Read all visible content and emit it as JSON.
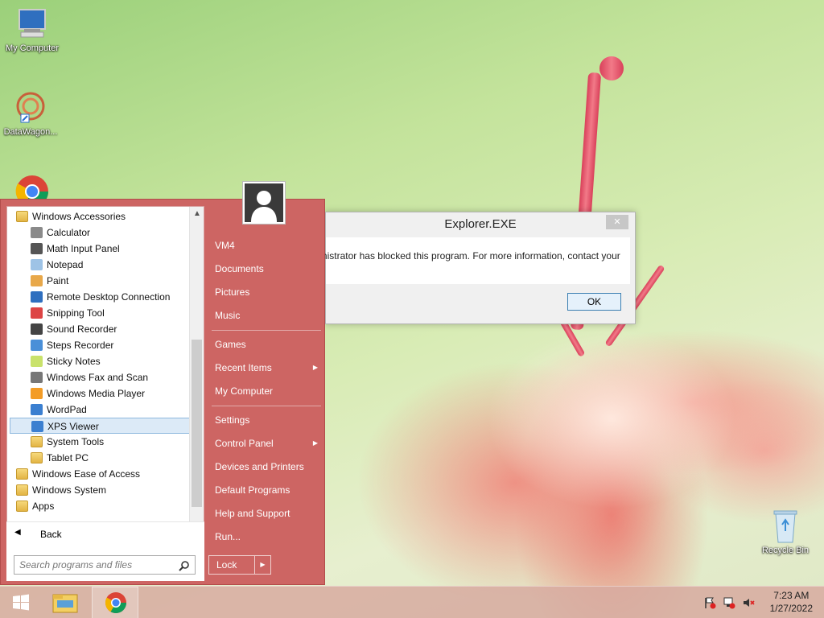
{
  "desktop": {
    "icons": [
      {
        "label": "My Computer",
        "icon": "computer-icon"
      },
      {
        "label": "DataWagon...",
        "icon": "datawagon-icon"
      },
      {
        "label": "",
        "icon": "chrome-icon"
      },
      {
        "label": "Recycle Bin",
        "icon": "recycle-bin-icon"
      }
    ]
  },
  "start_menu": {
    "programs": [
      {
        "label": "Windows Accessories",
        "icon": "folder-icon",
        "indent": 0
      },
      {
        "label": "Calculator",
        "icon": "calculator-icon",
        "indent": 1
      },
      {
        "label": "Math Input Panel",
        "icon": "math-input-icon",
        "indent": 1
      },
      {
        "label": "Notepad",
        "icon": "notepad-icon",
        "indent": 1
      },
      {
        "label": "Paint",
        "icon": "paint-icon",
        "indent": 1
      },
      {
        "label": "Remote Desktop Connection",
        "icon": "remote-desktop-icon",
        "indent": 1
      },
      {
        "label": "Snipping Tool",
        "icon": "snipping-tool-icon",
        "indent": 1
      },
      {
        "label": "Sound Recorder",
        "icon": "microphone-icon",
        "indent": 1
      },
      {
        "label": "Steps Recorder",
        "icon": "steps-recorder-icon",
        "indent": 1
      },
      {
        "label": "Sticky Notes",
        "icon": "sticky-notes-icon",
        "indent": 1
      },
      {
        "label": "Windows Fax and Scan",
        "icon": "fax-icon",
        "indent": 1
      },
      {
        "label": "Windows Media Player",
        "icon": "media-player-icon",
        "indent": 1
      },
      {
        "label": "WordPad",
        "icon": "wordpad-icon",
        "indent": 1
      },
      {
        "label": "XPS Viewer",
        "icon": "xps-viewer-icon",
        "indent": 1,
        "selected": true
      },
      {
        "label": "System Tools",
        "icon": "folder-icon",
        "indent": 1
      },
      {
        "label": "Tablet PC",
        "icon": "folder-icon",
        "indent": 1
      },
      {
        "label": "Windows Ease of Access",
        "icon": "folder-icon",
        "indent": 0
      },
      {
        "label": "Windows System",
        "icon": "folder-icon",
        "indent": 0
      },
      {
        "label": "Apps",
        "icon": "folder-icon",
        "indent": 0
      }
    ],
    "back_label": "Back",
    "search_placeholder": "Search programs and files",
    "right_items": [
      {
        "label": "VM4",
        "arrow": false
      },
      {
        "label": "Documents",
        "arrow": false
      },
      {
        "label": "Pictures",
        "arrow": false
      },
      {
        "label": "Music",
        "arrow": false
      },
      {
        "label": "Games",
        "arrow": false
      },
      {
        "label": "Recent Items",
        "arrow": true
      },
      {
        "label": "My Computer",
        "arrow": false
      },
      {
        "label": "Settings",
        "arrow": false
      },
      {
        "label": "Control Panel",
        "arrow": true
      },
      {
        "label": "Devices and Printers",
        "arrow": false
      },
      {
        "label": "Default Programs",
        "arrow": false
      },
      {
        "label": "Help and Support",
        "arrow": false
      },
      {
        "label": "Run...",
        "arrow": false
      }
    ],
    "lock_label": "Lock"
  },
  "dialog": {
    "title": "Explorer.EXE",
    "message": "Your system administrator has blocked this program. For more information, contact your",
    "ok_label": "OK",
    "close_glyph": "✕"
  },
  "taskbar": {
    "time": "7:23 AM",
    "date": "1/27/2022"
  }
}
